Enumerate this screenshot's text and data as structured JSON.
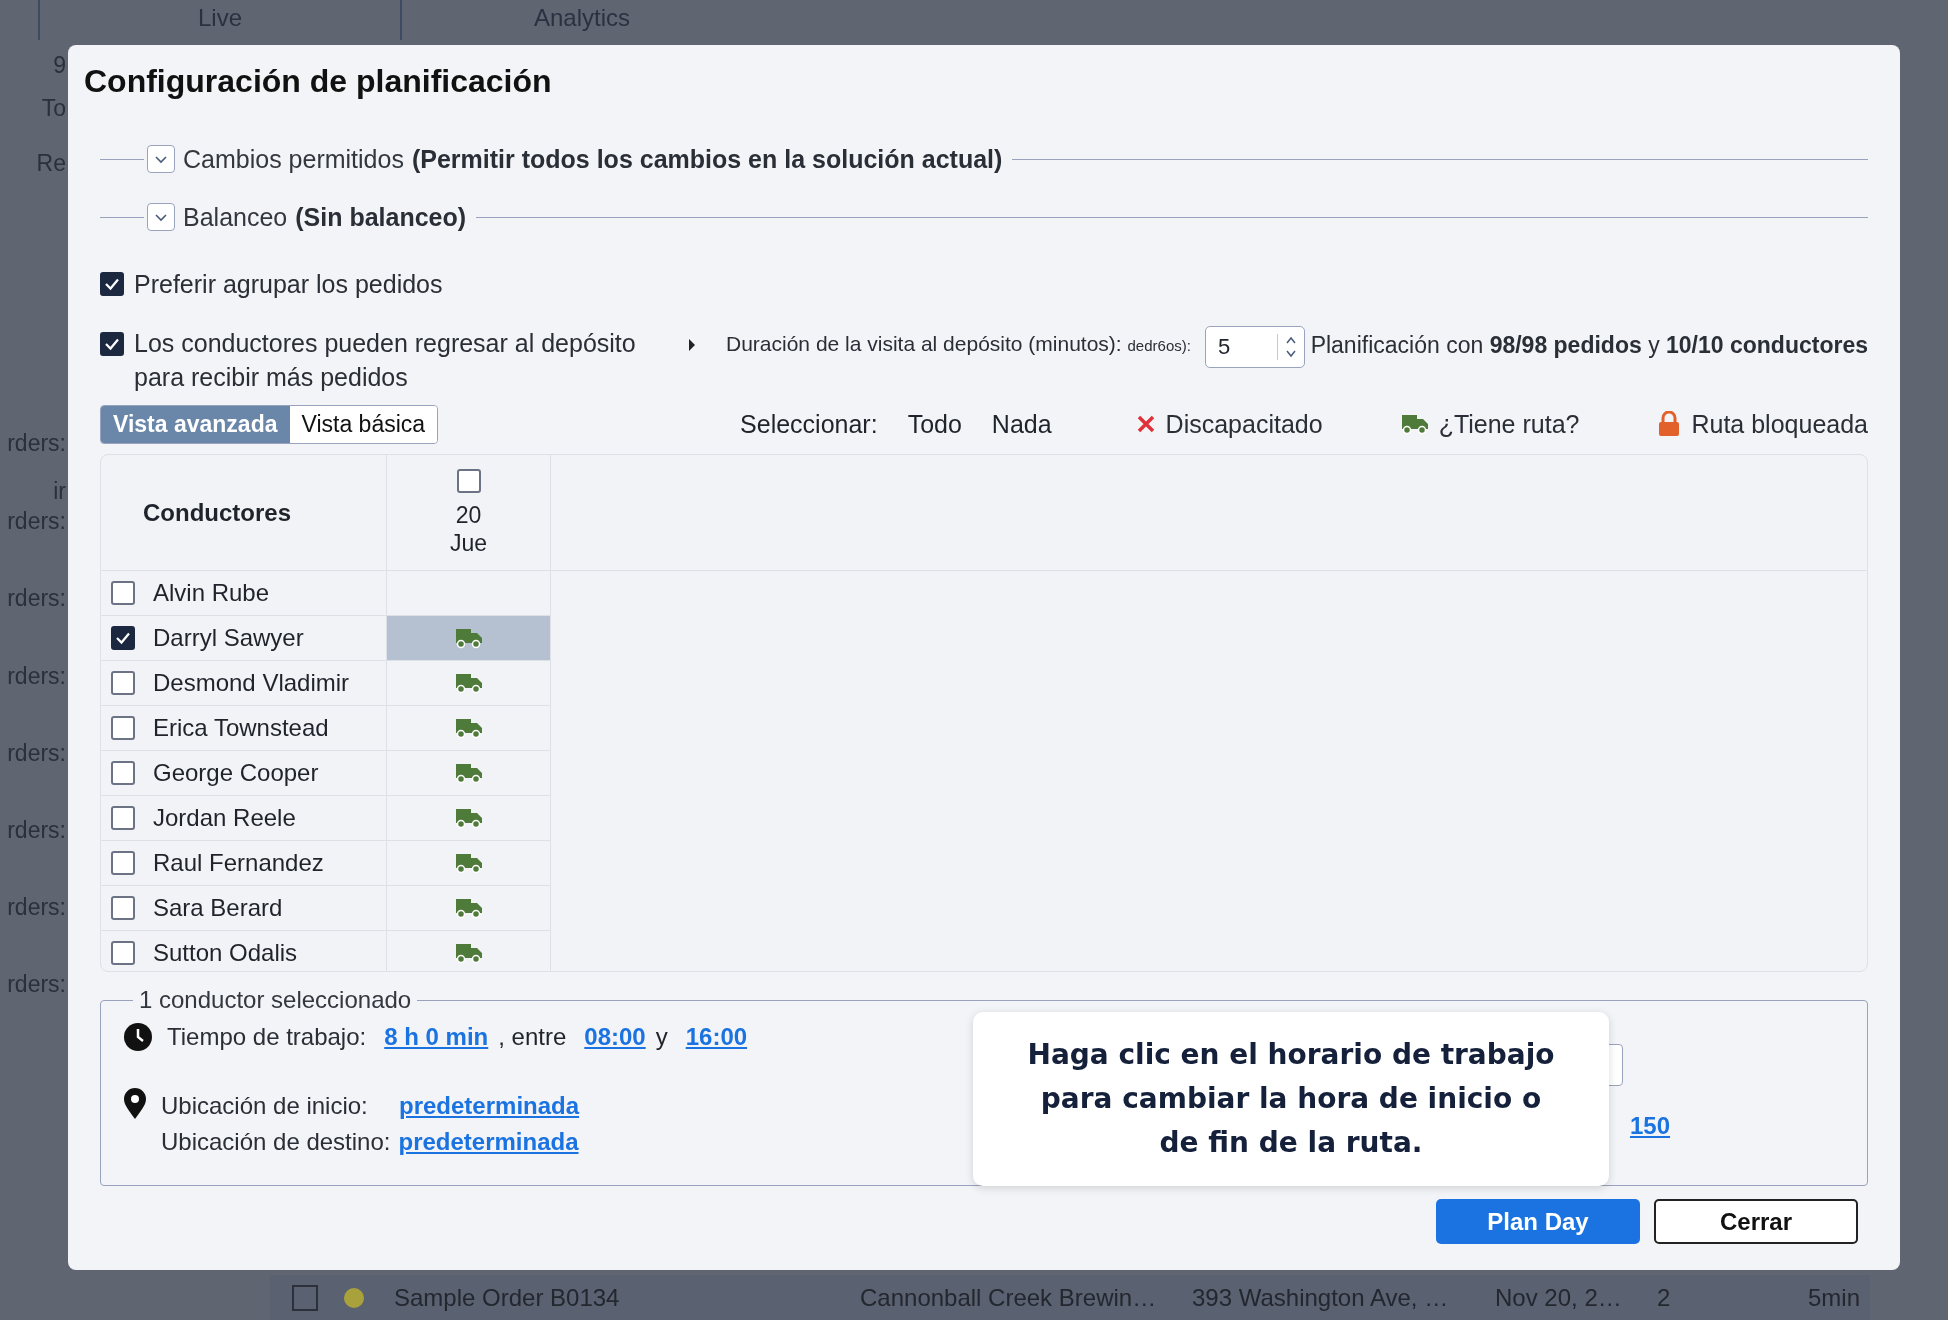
{
  "background": {
    "tabs": [
      "Live",
      "Analytics"
    ],
    "side_labels": [
      "9",
      "To",
      "Re",
      "rders:",
      "ir",
      "rders:",
      "rders:",
      "rders:",
      "rders:",
      "rders:",
      "rders:",
      "rders:"
    ],
    "order_row": {
      "checked": false,
      "color": "#a9a23c",
      "cells": [
        "Sample Order B0134",
        "Cannonball Creek Brewin…",
        "393 Washington Ave, …",
        "Nov 20, 2…",
        "2",
        "5min"
      ]
    }
  },
  "dialog": {
    "title": "Configuración de planificación",
    "sections": [
      {
        "label": "Cambios permitidos",
        "value": "(Permitir todos los cambios en la solución actual)",
        "expanded": false
      },
      {
        "label": "Balanceo",
        "value": "(Sin balanceo)",
        "expanded": false
      }
    ],
    "options": [
      {
        "label": "Preferir agrupar los pedidos",
        "checked": true
      },
      {
        "label": "Los conductores pueden regresar al depósito para recibir más pedidos",
        "checked": true
      }
    ],
    "depot_visit": {
      "label": "Duración de la visita al depósito (minutos):",
      "suffix": "dedr6os):",
      "value": "5"
    },
    "summary": "Planificación con **98/98 pedidos** y **10/10 conductores**",
    "view_tabs": [
      {
        "label": "Vista avanzada",
        "selected": true
      },
      {
        "label": "Vista básica",
        "selected": false
      }
    ],
    "select": {
      "label": "Seleccionar:",
      "links": [
        "Todo",
        "Nada"
      ]
    },
    "legend": [
      {
        "kind": "disabled",
        "label": "Discapacitado"
      },
      {
        "kind": "route",
        "label": "¿Tiene ruta?"
      },
      {
        "kind": "locked",
        "label": "Ruta bloqueada"
      }
    ],
    "table": {
      "column": "Conductores",
      "day": {
        "checked": false,
        "day": "20",
        "weekday": "Jue"
      },
      "rows": [
        {
          "name": "Alvin Rube",
          "checked": false,
          "has_route": false,
          "selected": false
        },
        {
          "name": "Darryl Sawyer",
          "checked": true,
          "has_route": true,
          "selected": true
        },
        {
          "name": "Desmond Vladimir",
          "checked": false,
          "has_route": true,
          "selected": false
        },
        {
          "name": "Erica Townstead",
          "checked": false,
          "has_route": true,
          "selected": false
        },
        {
          "name": "George Cooper",
          "checked": false,
          "has_route": true,
          "selected": false
        },
        {
          "name": "Jordan Reele",
          "checked": false,
          "has_route": true,
          "selected": false
        },
        {
          "name": "Raul Fernandez",
          "checked": false,
          "has_route": true,
          "selected": false
        },
        {
          "name": "Sara Berard",
          "checked": false,
          "has_route": true,
          "selected": false
        },
        {
          "name": "Sutton Odalis",
          "checked": false,
          "has_route": true,
          "selected": false
        }
      ]
    },
    "selection": {
      "legend": "1 conductor seleccionado",
      "work_label": "Tiempo de trabajo:",
      "duration": "8 h 0 min",
      "between": ", entre",
      "start": "08:00",
      "and": "y",
      "end": "16:00",
      "start_loc_label": "Ubicación de inicio:",
      "start_loc": "predeterminada",
      "end_loc_label": "Ubicación de destino:",
      "end_loc": "predeterminada",
      "extra_link": "150"
    },
    "tooltip": "Haga clic en el horario de trabajo para cambiar la hora de inicio o de fin de la ruta.",
    "buttons": [
      {
        "label": "Plan Day",
        "kind": "primary"
      },
      {
        "label": "Cerrar",
        "kind": "secondary"
      }
    ]
  }
}
